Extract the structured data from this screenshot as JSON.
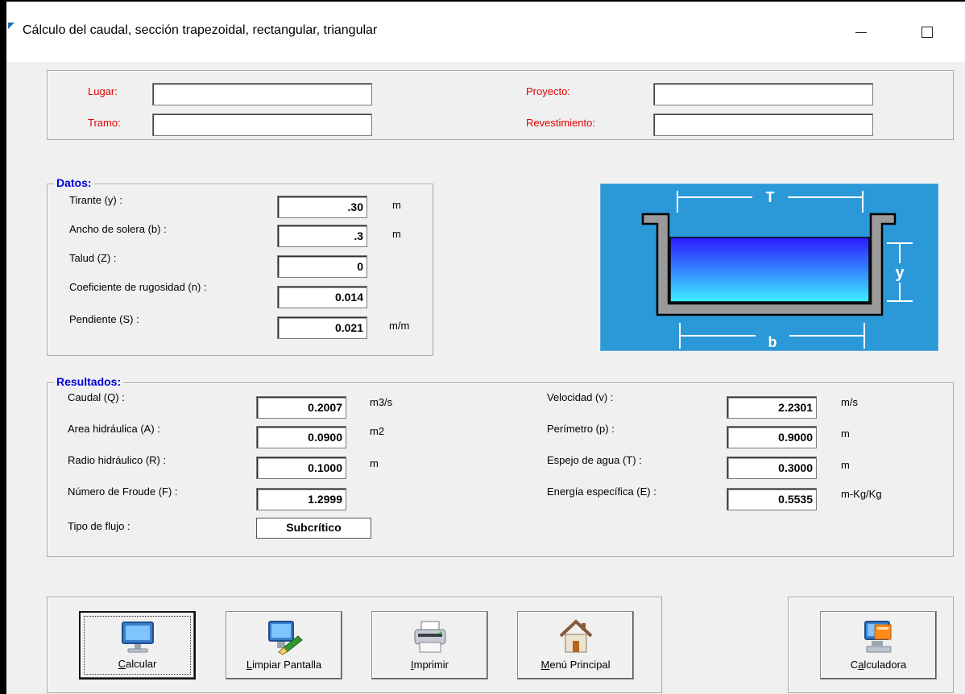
{
  "window": {
    "title": "Cálculo del caudal, sección trapezoidal, rectangular, triangular"
  },
  "header": {
    "lugar_label": "Lugar:",
    "tramo_label": "Tramo:",
    "proyecto_label": "Proyecto:",
    "revestimiento_label": "Revestimiento:",
    "lugar_value": "",
    "tramo_value": "",
    "proyecto_value": "",
    "revestimiento_value": ""
  },
  "datos": {
    "title": "Datos:",
    "fields": [
      {
        "label": "Tirante (y) :",
        "value": ".30",
        "unit": "m"
      },
      {
        "label": "Ancho de solera (b) :",
        "value": ".3",
        "unit": "m"
      },
      {
        "label": "Talud  (Z) :",
        "value": "0",
        "unit": ""
      },
      {
        "label": "Coeficiente de rugosidad (n) :",
        "value": "0.014",
        "unit": ""
      },
      {
        "label": "Pendiente (S) :",
        "value": "0.021",
        "unit": "m/m"
      }
    ]
  },
  "diagram": {
    "top_label": "T",
    "depth_label": "y",
    "bottom_label": "b"
  },
  "resultados": {
    "title": "Resultados:",
    "left": [
      {
        "label": "Caudal (Q) :",
        "value": "0.2007",
        "unit": "m3/s"
      },
      {
        "label": "Area hidráulica (A) :",
        "value": "0.0900",
        "unit": "m2"
      },
      {
        "label": "Radio hidráulico (R) :",
        "value": "0.1000",
        "unit": "m"
      },
      {
        "label": "Número de Froude (F) :",
        "value": "1.2999",
        "unit": ""
      }
    ],
    "right": [
      {
        "label": "Velocidad (v) :",
        "value": "2.2301",
        "unit": "m/s"
      },
      {
        "label": "Perímetro (p) :",
        "value": "0.9000",
        "unit": "m"
      },
      {
        "label": "Espejo de agua (T) :",
        "value": "0.3000",
        "unit": "m"
      },
      {
        "label": "Energía específica (E) :",
        "value": "0.5535",
        "unit": "m-Kg/Kg"
      }
    ],
    "flow_type_label": "Tipo de flujo :",
    "flow_type_value": "Subcrítico"
  },
  "buttons": {
    "calcular": {
      "pre": "",
      "u": "C",
      "post": "alcular",
      "icon": "monitor-icon"
    },
    "limpiar": {
      "pre": "",
      "u": "L",
      "post": "impiar Pantalla",
      "icon": "eraser-monitor-icon"
    },
    "imprimir": {
      "pre": "",
      "u": "I",
      "post": "mprimir",
      "icon": "printer-icon"
    },
    "menu": {
      "pre": "",
      "u": "M",
      "post": "enú Principal",
      "icon": "house-icon"
    },
    "calculadora": {
      "pre": "C",
      "u": "a",
      "post": "lculadora",
      "icon": "calculator-icon"
    }
  },
  "colors": {
    "label_red": "#e00000",
    "legend_blue": "#0000dd",
    "diagram_bg": "#2b98d8"
  }
}
